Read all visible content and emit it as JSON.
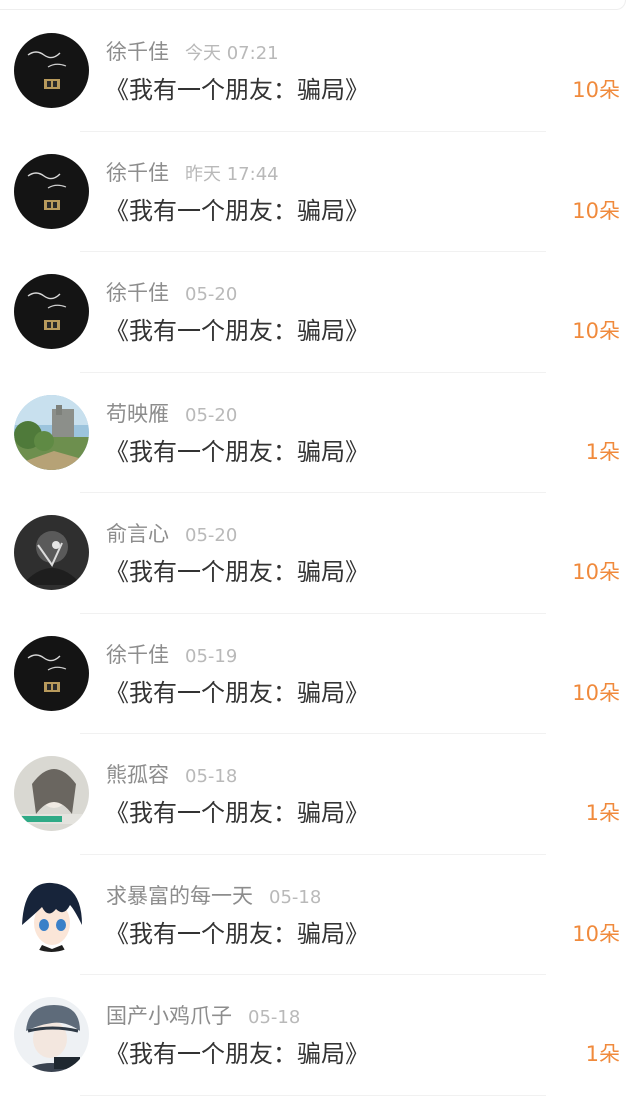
{
  "records": [
    {
      "user": "徐千佳",
      "time": "今天 07:21",
      "title": "《我有一个朋友：骗局》",
      "amount": "10朵",
      "avatar": "dark-movie-poster"
    },
    {
      "user": "徐千佳",
      "time": "昨天 17:44",
      "title": "《我有一个朋友：骗局》",
      "amount": "10朵",
      "avatar": "dark-movie-poster"
    },
    {
      "user": "徐千佳",
      "time": "05-20",
      "title": "《我有一个朋友：骗局》",
      "amount": "10朵",
      "avatar": "dark-movie-poster"
    },
    {
      "user": "苟映雁",
      "time": "05-20",
      "title": "《我有一个朋友：骗局》",
      "amount": "1朵",
      "avatar": "anime-landscape"
    },
    {
      "user": "俞言心",
      "time": "05-20",
      "title": "《我有一个朋友：骗局》",
      "amount": "10朵",
      "avatar": "grey-portrait"
    },
    {
      "user": "徐千佳",
      "time": "05-19",
      "title": "《我有一个朋友：骗局》",
      "amount": "10朵",
      "avatar": "dark-movie-poster"
    },
    {
      "user": "熊孤容",
      "time": "05-18",
      "title": "《我有一个朋友：骗局》",
      "amount": "1朵",
      "avatar": "girl-photo"
    },
    {
      "user": "求暴富的每一天",
      "time": "05-18",
      "title": "《我有一个朋友：骗局》",
      "amount": "10朵",
      "avatar": "anime-boy"
    },
    {
      "user": "国产小鸡爪子",
      "time": "05-18",
      "title": "《我有一个朋友：骗局》",
      "amount": "1朵",
      "avatar": "helmet-boy"
    }
  ],
  "colors": {
    "amount": "#f08a3c",
    "username": "#8d8d8d",
    "time": "#b9b9b9",
    "title": "#333333"
  }
}
